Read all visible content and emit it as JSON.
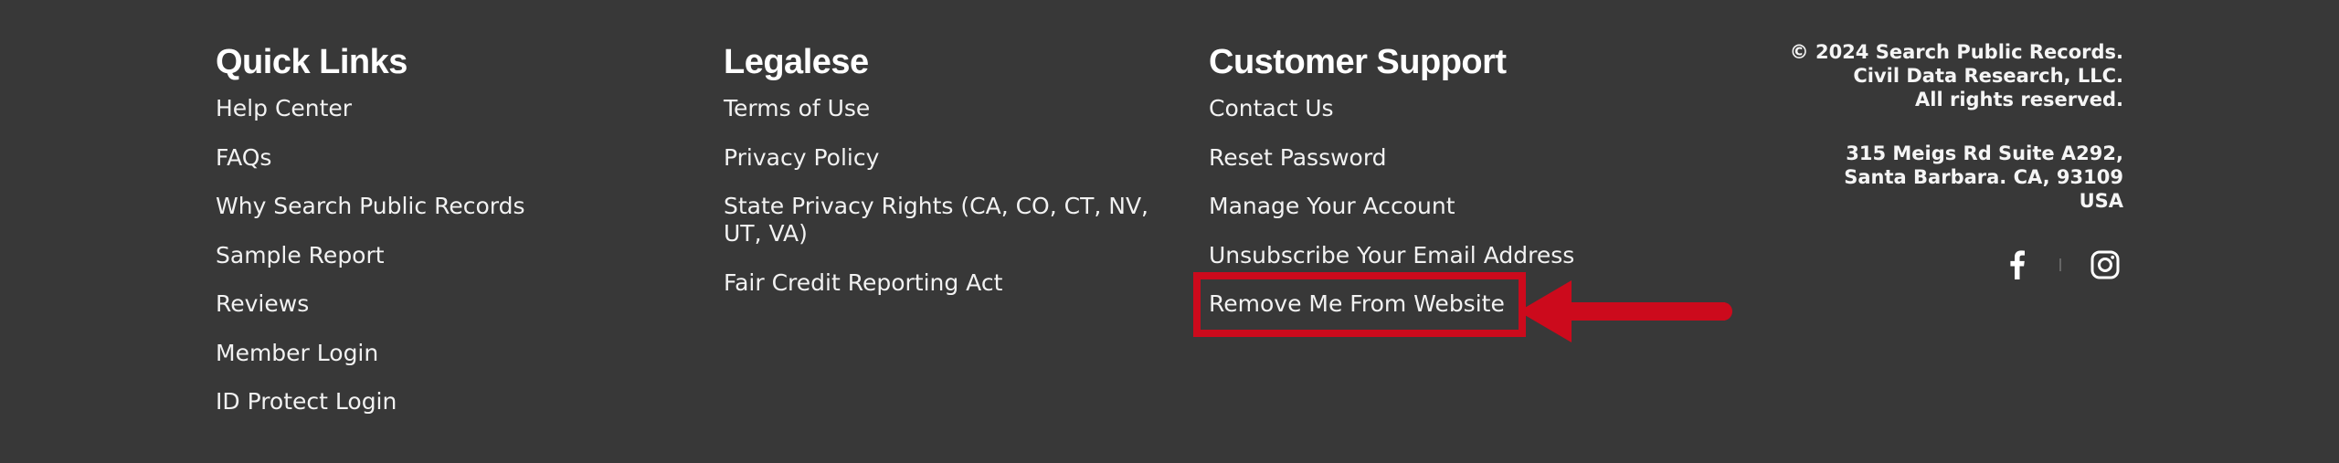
{
  "quick_links": {
    "heading": "Quick Links",
    "items": [
      {
        "label": "Help Center"
      },
      {
        "label": "FAQs"
      },
      {
        "label": "Why Search Public Records"
      },
      {
        "label": "Sample Report"
      },
      {
        "label": "Reviews"
      },
      {
        "label": "Member Login"
      },
      {
        "label": "ID Protect Login"
      }
    ]
  },
  "legalese": {
    "heading": "Legalese",
    "items": [
      {
        "label": "Terms of Use"
      },
      {
        "label": "Privacy Policy"
      },
      {
        "label": "State Privacy Rights (CA, CO, CT, NV, UT, VA)"
      },
      {
        "label": "Fair Credit Reporting Act"
      }
    ]
  },
  "customer_support": {
    "heading": "Customer Support",
    "items": [
      {
        "label": "Contact Us"
      },
      {
        "label": "Reset Password"
      },
      {
        "label": "Manage Your Account"
      },
      {
        "label": "Unsubscribe Your Email Address"
      },
      {
        "label": "Remove Me From Website"
      }
    ]
  },
  "company": {
    "copyright_line1": "© 2024 Search Public Records.",
    "copyright_line2": "Civil Data Research, LLC.",
    "copyright_line3": "All rights reserved.",
    "address_line1": "315 Meigs Rd Suite A292,",
    "address_line2": "Santa Barbara. CA, 93109",
    "address_line3": "USA"
  },
  "social": {
    "icons": [
      "facebook-icon",
      "instagram-icon"
    ]
  },
  "colors": {
    "background": "#383838",
    "text": "#ffffff",
    "annotation_red": "#cc0a1c"
  }
}
